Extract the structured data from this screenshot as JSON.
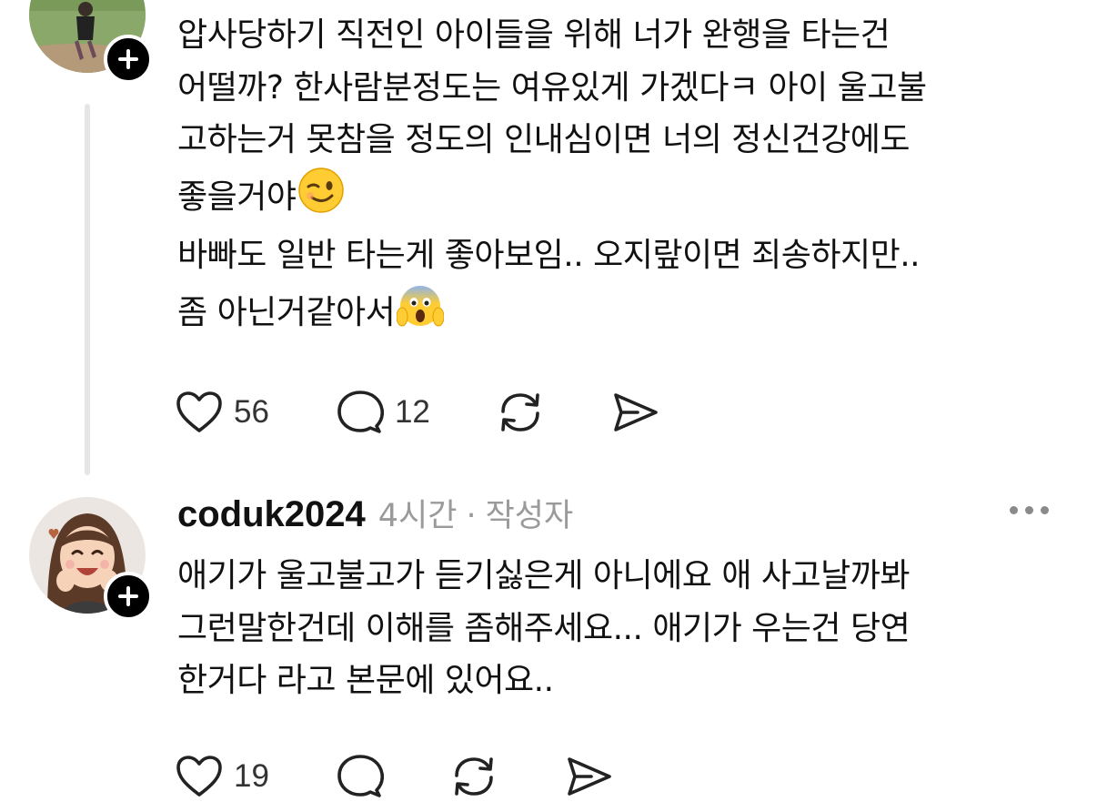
{
  "first_reply": {
    "lines": [
      "압사당하기 직전인 아이들을 위해 너가 완행을 타는건",
      "어떨까? 한사람분정도는 여유있게 가겠다ㅋ 아이 울고불",
      "고하는거 못참을 정도의 인내심이면 너의 정신건강에도",
      "좋을거야",
      "바빠도 일반 타는게 좋아보임.. 오지랖이면 죄송하지만..",
      "좀 아닌거같아서"
    ],
    "emoji_wink": "winking-face",
    "emoji_scream": "face-screaming-in-fear",
    "likes": "56",
    "replies": "12"
  },
  "second_reply": {
    "username": "coduk2024",
    "time": "4시간",
    "separator": "·",
    "author_tag": "작성자",
    "lines": [
      "애기가 울고불고가 듣기싫은게 아니에요 애 사고날까봐",
      "그런말한건데 이해를 좀해주세요... 애기가 우는건 당연",
      "한거다 라고 본문에 있어요.."
    ],
    "likes": "19"
  },
  "icons": [
    "heart-icon",
    "comment-icon",
    "repost-icon",
    "share-icon",
    "plus-icon",
    "more-icon"
  ]
}
